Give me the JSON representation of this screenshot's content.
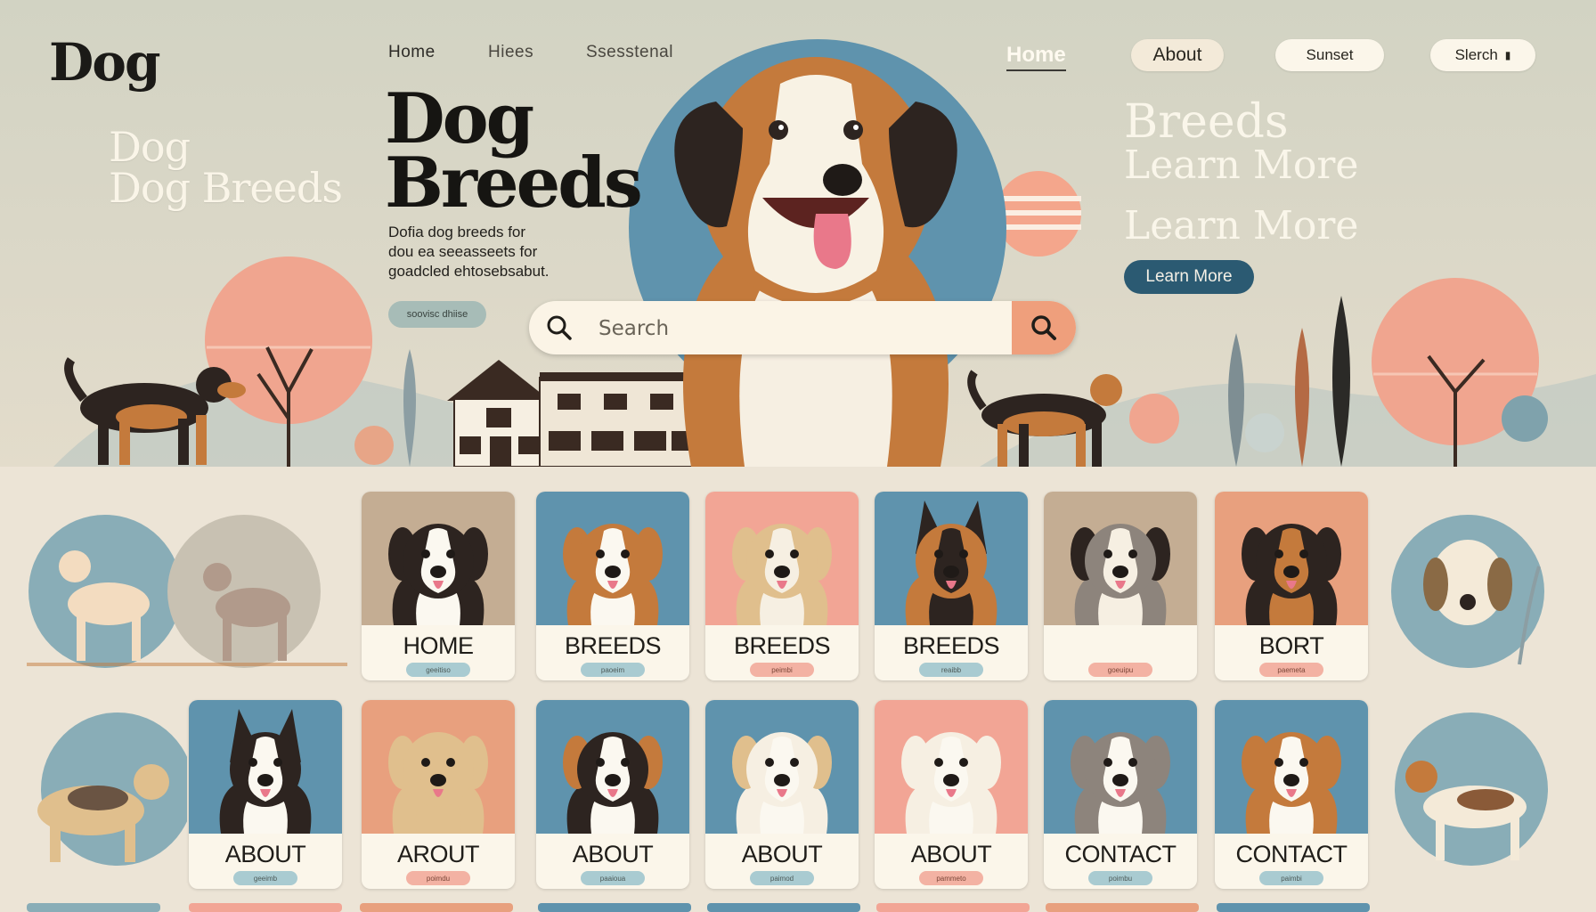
{
  "brand": {
    "logo": "Dog"
  },
  "nav_left": {
    "home": "Home",
    "breeds": "Hiees",
    "seasonal": "Ssesstenal"
  },
  "nav_right": {
    "home": "Home",
    "about": "About",
    "sunset": "Sunset",
    "search": "Slerch"
  },
  "hero": {
    "title_left_line1": "Dog",
    "title_left_line2": "Dog Breeds",
    "title_main_line1": "Dog",
    "title_main_line2": "Breeds",
    "description_line1": "Dofia dog breeds for",
    "description_line2": "dou ea seeasseets for",
    "description_line3": "goadcled ehtosebsabut.",
    "pill": "soovisc dhiise",
    "right_breeds": "Breeds",
    "right_learn_1": "Learn More",
    "right_learn_2": "Learn More",
    "learn_more_button": "Learn More"
  },
  "search": {
    "placeholder": "Search"
  },
  "colors": {
    "navy": "#2b5a72",
    "blue": "#5f93ad",
    "peach": "#ef9f7c",
    "tan": "#c47a3c",
    "cream": "#fbf6ea",
    "pink": "#f2a595"
  },
  "cards_row1": [
    {
      "label": "HOME",
      "pill": "geeitiso",
      "bg": "#c4ad93",
      "dog": "border-collie"
    },
    {
      "label": "BREEDS",
      "pill": "paoeim",
      "bg": "#5f93ad",
      "dog": "sheltie"
    },
    {
      "label": "BREEDS",
      "pill": "peimbi",
      "bg": "#f2a595",
      "dog": "mixed-tan"
    },
    {
      "label": "BREEDS",
      "pill": "reaibb",
      "bg": "#5f93ad",
      "dog": "german-shepherd"
    },
    {
      "label": "",
      "pill": "goeuipu",
      "bg": "#c4ad93",
      "dog": "boxer"
    },
    {
      "label": "BORT",
      "pill": "paemeta",
      "bg": "#e8a07e",
      "dog": "rottweiler"
    }
  ],
  "cards_row2": [
    {
      "label": "ABOUT",
      "pill": "geeimb",
      "bg": "#5f93ad",
      "dog": "husky"
    },
    {
      "label": "AROUT",
      "pill": "poimdu",
      "bg": "#e8a07e",
      "dog": "golden"
    },
    {
      "label": "ABOUT",
      "pill": "paaioua",
      "bg": "#5f93ad",
      "dog": "bernese"
    },
    {
      "label": "ABOUT",
      "pill": "paimod",
      "bg": "#5f93ad",
      "dog": "white-mix"
    },
    {
      "label": "ABOUT",
      "pill": "pammeto",
      "bg": "#f2a595",
      "dog": "labrador"
    },
    {
      "label": "CONTACT",
      "pill": "poimbu",
      "bg": "#5f93ad",
      "dog": "pitbull"
    },
    {
      "label": "CONTACT",
      "pill": "paimbi",
      "bg": "#5f93ad",
      "dog": "beagle"
    }
  ]
}
